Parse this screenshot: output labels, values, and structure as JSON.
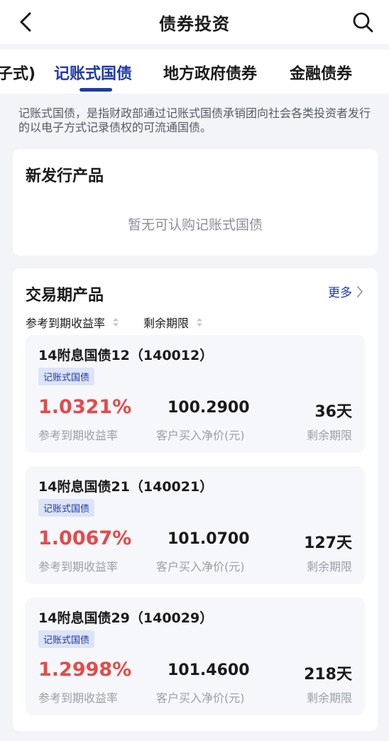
{
  "header": {
    "title": "债券投资",
    "back_icon": "chevron-left-icon",
    "search_icon": "search-icon"
  },
  "tabs": [
    {
      "label": "子式)",
      "active": false
    },
    {
      "label": "记账式国债",
      "active": true
    },
    {
      "label": "地方政府债券",
      "active": false
    },
    {
      "label": "金融债券",
      "active": false
    }
  ],
  "description": "记账式国债，是指财政部通过记账式国债承销团向社会各类投资者发行的以电子方式记录债权的可流通国债。",
  "new_issue": {
    "title": "新发行产品",
    "empty_text": "暂无可认购记账式国债"
  },
  "trading": {
    "title": "交易期产品",
    "more_label": "更多",
    "sort_options": [
      "参考到期收益率",
      "剩余期限"
    ],
    "bonds": [
      {
        "name": "14附息国债12（140012）",
        "tag": "记账式国债",
        "rate": "1.0321%",
        "price": "100.2900",
        "term": "36天",
        "rate_label": "参考到期收益率",
        "price_label": "客户买入净价(元)",
        "term_label": "剩余期限"
      },
      {
        "name": "14附息国债21（140021）",
        "tag": "记账式国债",
        "rate": "1.0067%",
        "price": "101.0700",
        "term": "127天",
        "rate_label": "参考到期收益率",
        "price_label": "客户买入净价(元)",
        "term_label": "剩余期限"
      },
      {
        "name": "14附息国债29（140029）",
        "tag": "记账式国债",
        "rate": "1.2998%",
        "price": "101.4600",
        "term": "218天",
        "rate_label": "参考到期收益率",
        "price_label": "客户买入净价(元)",
        "term_label": "剩余期限"
      }
    ]
  },
  "colors": {
    "accent": "#1f3aa8",
    "rate_red": "#e44a4a",
    "background": "#f3f4f7"
  }
}
